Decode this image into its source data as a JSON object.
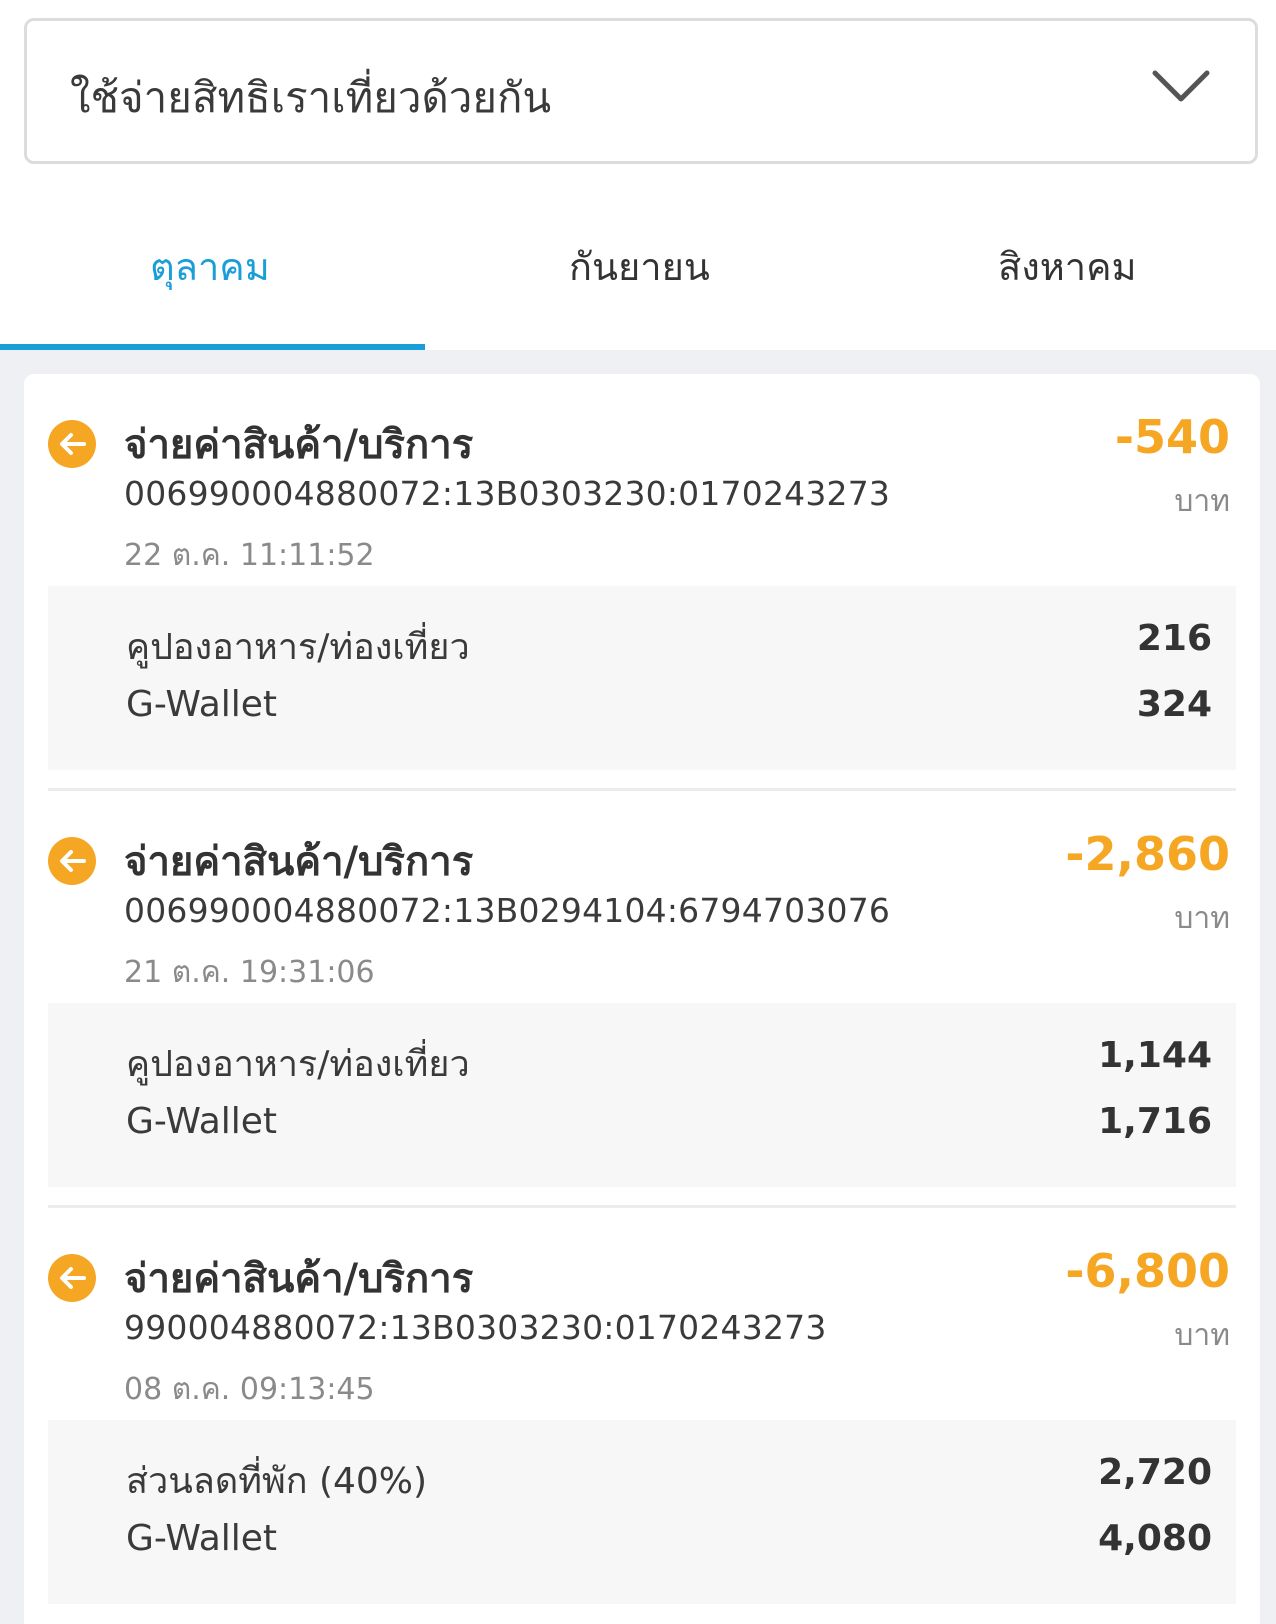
{
  "selector": {
    "label": "ใช้จ่ายสิทธิเราเที่ยวด้วยกัน",
    "icon": "chevron-down-icon"
  },
  "tabs": [
    {
      "label": "ตุลาคม",
      "active": true
    },
    {
      "label": "กันยายน",
      "active": false
    },
    {
      "label": "สิงหาคม",
      "active": false
    }
  ],
  "colors": {
    "accent": "#1a9ed8",
    "amount": "#f5a623",
    "icon": "#f5a623"
  },
  "transactions": [
    {
      "icon": "arrow-left-icon",
      "title": "จ่ายค่าสินค้า/บริการ",
      "reference": "006990004880072:13B0303230:0170243273",
      "datetime": "22 ต.ค. 11:11:52",
      "amount": "-540",
      "unit": "บาท",
      "breakdown": [
        {
          "label": "คูปองอาหาร/ท่องเที่ยว",
          "value": "216"
        },
        {
          "label": "G-Wallet",
          "value": "324"
        }
      ]
    },
    {
      "icon": "arrow-left-icon",
      "title": "จ่ายค่าสินค้า/บริการ",
      "reference": "006990004880072:13B0294104:6794703076",
      "datetime": "21 ต.ค. 19:31:06",
      "amount": "-2,860",
      "unit": "บาท",
      "breakdown": [
        {
          "label": "คูปองอาหาร/ท่องเที่ยว",
          "value": "1,144"
        },
        {
          "label": "G-Wallet",
          "value": "1,716"
        }
      ]
    },
    {
      "icon": "arrow-left-icon",
      "title": "จ่ายค่าสินค้า/บริการ",
      "reference": "990004880072:13B0303230:0170243273",
      "datetime": "08 ต.ค. 09:13:45",
      "amount": "-6,800",
      "unit": "บาท",
      "breakdown": [
        {
          "label": "ส่วนลดที่พัก (40%)",
          "value": "2,720"
        },
        {
          "label": "G-Wallet",
          "value": "4,080"
        }
      ]
    }
  ]
}
